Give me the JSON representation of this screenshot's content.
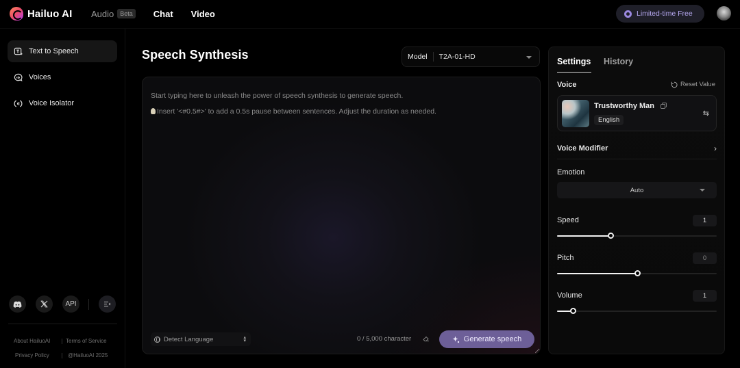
{
  "app": {
    "name": "Hailuo AI",
    "nav": [
      {
        "label": "Audio",
        "badge": "Beta"
      },
      {
        "label": "Chat"
      },
      {
        "label": "Video"
      }
    ],
    "promo_label": "Limited-time Free"
  },
  "sidebar": {
    "items": [
      {
        "label": "Text to Speech",
        "icon": "text-to-speech-icon",
        "active": true
      },
      {
        "label": "Voices",
        "icon": "voices-icon"
      },
      {
        "label": "Voice Isolator",
        "icon": "voice-isolator-icon"
      }
    ],
    "socials": [
      {
        "name": "discord-icon"
      },
      {
        "name": "x-icon"
      },
      {
        "name": "api-link",
        "label": "API"
      },
      {
        "name": "collapse-sidebar-icon"
      }
    ],
    "footer": {
      "about": "About HailuoAI",
      "terms": "Terms of Service",
      "privacy": "Privacy Policy",
      "copyright": "@HailuoAI 2025"
    }
  },
  "main": {
    "title": "Speech Synthesis",
    "model": {
      "label": "Model",
      "value": "T2A-01-HD"
    },
    "editor": {
      "placeholder_line1": "Start typing here to unleash the power of speech synthesis to generate speech.",
      "placeholder_line2": "Insert '<#0.5#>' to add a 0.5s pause between sentences. Adjust the duration as needed.",
      "value": ""
    },
    "language_select": "Detect Language",
    "char_count": "0 / 5,000 character",
    "generate_label": "Generate speech"
  },
  "settings": {
    "tabs": [
      {
        "label": "Settings",
        "active": true
      },
      {
        "label": "History",
        "active": false
      }
    ],
    "voice_label": "Voice",
    "reset_label": "Reset Value",
    "voice": {
      "name": "Trustworthy Man",
      "language": "English"
    },
    "voice_modifier_label": "Voice Modifier",
    "emotion_label": "Emotion",
    "emotion_value": "Auto",
    "sliders": [
      {
        "label": "Speed",
        "value": "1",
        "fraction": 0.333
      },
      {
        "label": "Pitch",
        "value": "0",
        "fraction": 0.5
      },
      {
        "label": "Volume",
        "value": "1",
        "fraction": 0.1
      }
    ]
  },
  "colors": {
    "accent": "#6d5f98",
    "promo_text": "#b6a8f0",
    "background": "#000000"
  }
}
